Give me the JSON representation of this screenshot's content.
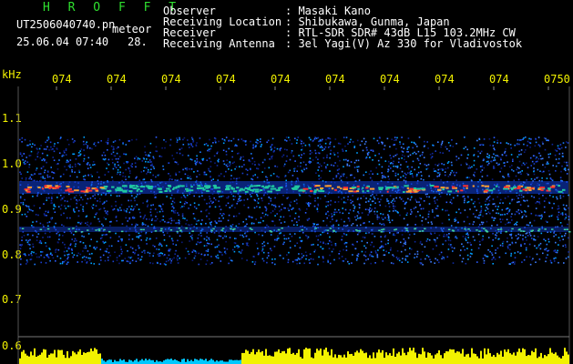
{
  "header": {
    "title": "H R O F F T",
    "filename": "UT2506040740.pn",
    "tag": "meteor",
    "datetime": "25.06.04 07:40",
    "number": "28.",
    "info_labels": [
      "Observer",
      "Receiving Location",
      "Receiver",
      "Receiving Antenna"
    ],
    "info_values": [
      ": Masaki Kano",
      ": Shibukawa, Gunma, Japan",
      ": RTL-SDR SDR# 43dB L15 103.2MHz CW",
      ": 3el Yagi(V) Az 330 for Vladivostok"
    ]
  },
  "time_axis": {
    "labels": [
      "074",
      "074",
      "074",
      "074",
      "074",
      "074",
      "074",
      "074",
      "074",
      "0750"
    ]
  },
  "freq_axis": {
    "unit": "kHz",
    "labels": [
      "1.1",
      "1.0",
      "0.9",
      "0.8",
      "0.7",
      "0.6"
    ]
  },
  "colors": {
    "background": "#000000",
    "text": "#ffffff",
    "title": "#2fe02f",
    "axis_labels": "#f2f200",
    "signal_band": "#ff3030",
    "noise": "#1a3fd0",
    "amplitude": "#f2f200",
    "amplitude_low": "#00c8ff"
  }
}
